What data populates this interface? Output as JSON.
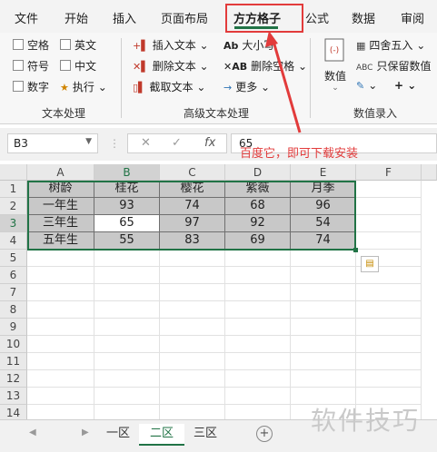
{
  "menu": {
    "tabs": [
      "文件",
      "开始",
      "插入",
      "页面布局",
      "方方格子",
      "公式",
      "数据",
      "审阅"
    ],
    "active_tab": "方方格子"
  },
  "ribbon": {
    "text_group": {
      "label": "文本处理",
      "checkboxes": [
        "空格",
        "英文",
        "符号",
        "中文",
        "数字"
      ],
      "execute_label": "执行"
    },
    "advanced_group": {
      "label": "高级文本处理",
      "commands": [
        "插入文本",
        "删除文本",
        "截取文本",
        "大小写",
        "删除空格",
        "更多"
      ]
    },
    "numeric_group": {
      "label": "数值录入",
      "big_button": "数值",
      "commands": [
        "四舍五入",
        "只保留数值"
      ]
    }
  },
  "formula_bar": {
    "name_box": "B3",
    "formula_value": "65"
  },
  "annotation": {
    "text": "百度它，即可下载安装"
  },
  "sheet": {
    "columns": [
      "A",
      "B",
      "C",
      "D",
      "E",
      "F"
    ],
    "rows": [
      "1",
      "2",
      "3",
      "4",
      "5",
      "6",
      "7",
      "8",
      "9",
      "10",
      "11",
      "12",
      "13",
      "14"
    ],
    "table": [
      [
        "树龄",
        "桂花",
        "樱花",
        "紫薇",
        "月季"
      ],
      [
        "一年生",
        "93",
        "74",
        "68",
        "96"
      ],
      [
        "三年生",
        "65",
        "97",
        "92",
        "54"
      ],
      [
        "五年生",
        "55",
        "83",
        "69",
        "74"
      ]
    ],
    "active_cell": "B3"
  },
  "sheet_tabs": {
    "tabs": [
      "一区",
      "二区",
      "三区"
    ],
    "active": "二区"
  },
  "watermark": "软件技巧"
}
